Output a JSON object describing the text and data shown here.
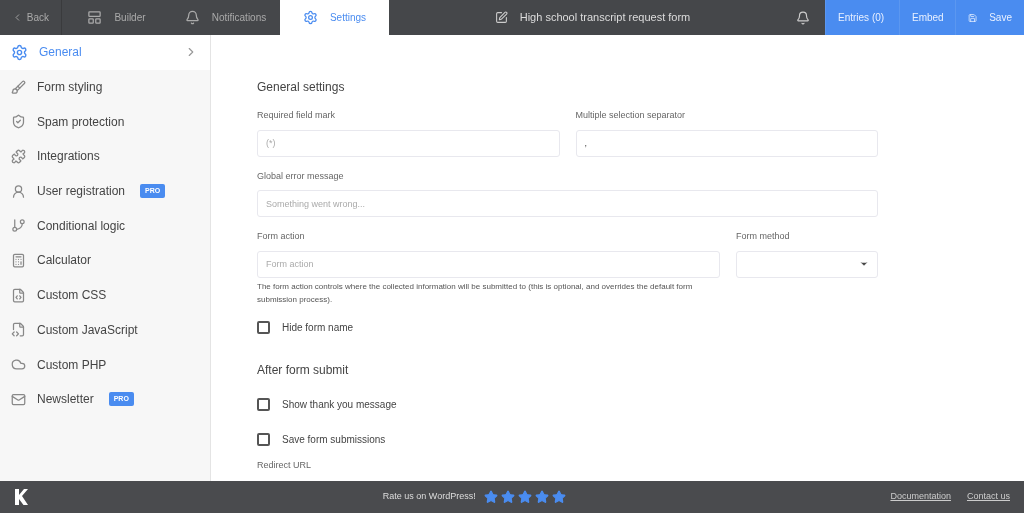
{
  "topbar": {
    "back": "Back",
    "tabs": [
      {
        "label": "Builder",
        "selected": false
      },
      {
        "label": "Notifications",
        "selected": false
      },
      {
        "label": "Settings",
        "selected": true
      }
    ],
    "form_title": "High school transcript request form",
    "buttons": [
      "Entries (0)",
      "Embed",
      "Save"
    ]
  },
  "sidebar": {
    "items": [
      {
        "label": "General",
        "selected": true
      },
      {
        "label": "Form styling",
        "selected": false
      },
      {
        "label": "Spam protection",
        "selected": false
      },
      {
        "label": "Integrations",
        "selected": false
      },
      {
        "label": "User registration",
        "selected": false,
        "badge": "PRO"
      },
      {
        "label": "Conditional logic",
        "selected": false
      },
      {
        "label": "Calculator",
        "selected": false
      },
      {
        "label": "Custom CSS",
        "selected": false
      },
      {
        "label": "Custom JavaScript",
        "selected": false
      },
      {
        "label": "Custom PHP",
        "selected": false
      },
      {
        "label": "Newsletter",
        "selected": false,
        "badge": "PRO"
      }
    ]
  },
  "general": {
    "title": "General settings",
    "required_mark": {
      "label": "Required field mark",
      "placeholder": "(*)"
    },
    "separator": {
      "label": "Multiple selection separator",
      "value": ","
    },
    "error_message": {
      "label": "Global error message",
      "placeholder": "Something went wrong..."
    },
    "form_action": {
      "label": "Form action",
      "placeholder": "Form action",
      "help": "The form action controls where the collected information will be submitted to (this is optional, and overrides the default form submission process)."
    },
    "form_method": {
      "label": "Form method"
    },
    "hide_name": {
      "label": "Hide form name",
      "checked": false
    }
  },
  "after_submit": {
    "title": "After form submit",
    "options": [
      {
        "label": "Show thank you message",
        "checked": false
      },
      {
        "label": "Save form submissions",
        "checked": false
      }
    ],
    "redirect_label": "Redirect URL"
  },
  "footer": {
    "rate": "Rate us on WordPress!",
    "stars": 5,
    "links": [
      "Documentation",
      "Contact us"
    ]
  }
}
